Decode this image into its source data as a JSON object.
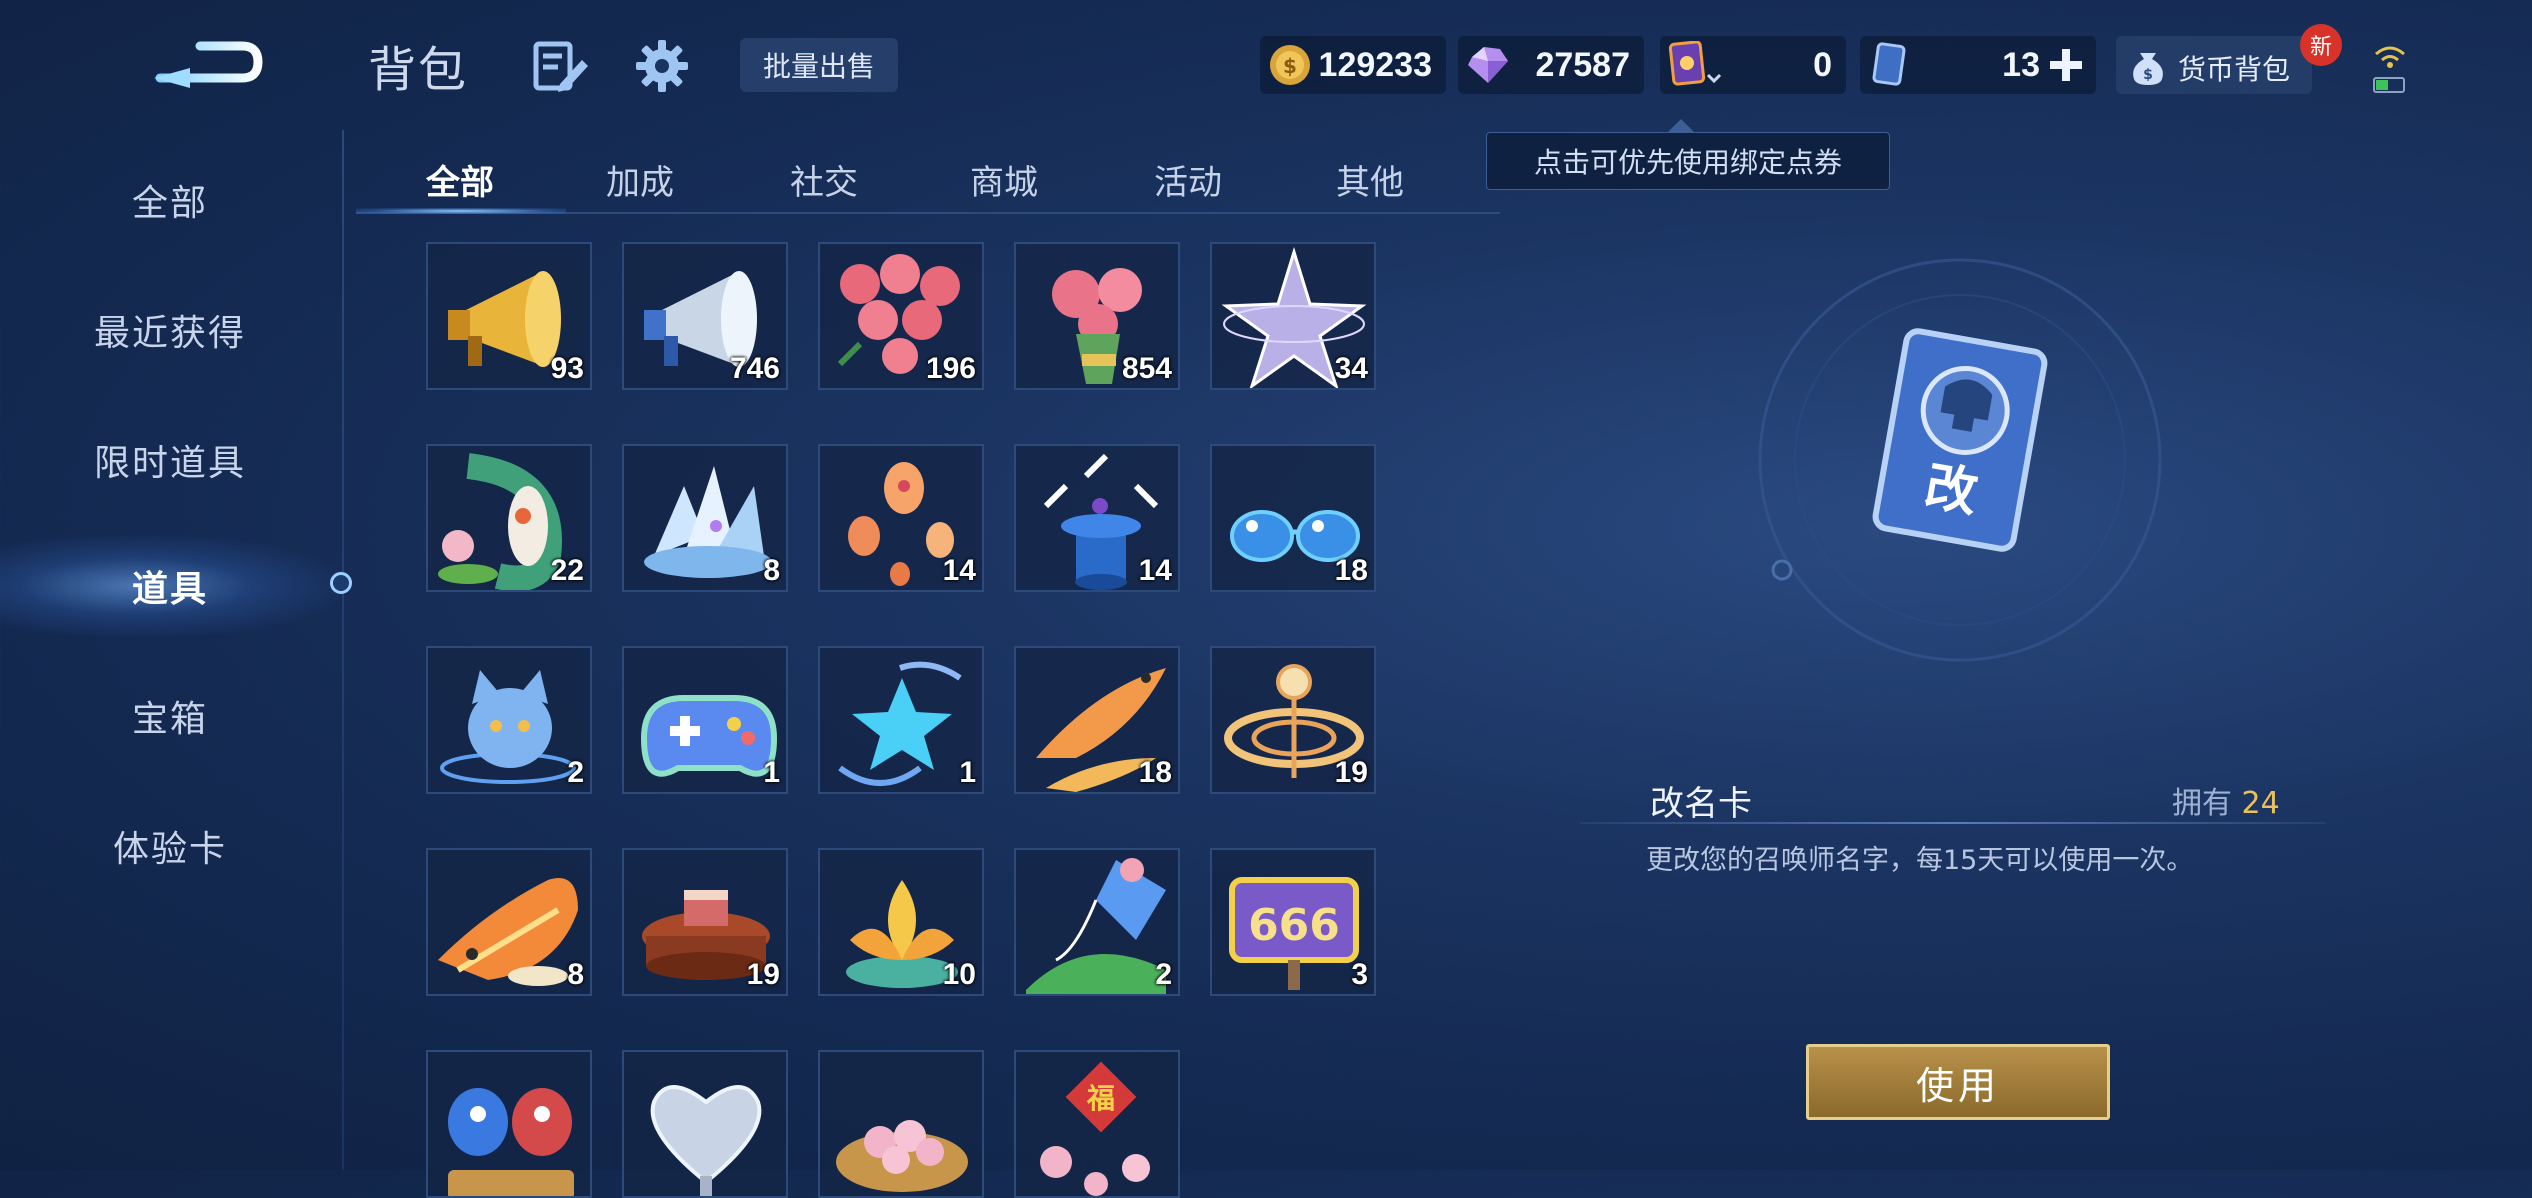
{
  "header": {
    "title": "背包",
    "bulk_sell": "批量出售"
  },
  "currencies": {
    "gold": "129233",
    "diamond": "27587",
    "voucher": "0",
    "ticket": "13",
    "wallet_label": "货币背包",
    "new_badge": "新"
  },
  "tooltip": "点击可优先使用绑定点券",
  "sidebar": {
    "items": [
      {
        "label": "全部"
      },
      {
        "label": "最近获得"
      },
      {
        "label": "限时道具"
      },
      {
        "label": "道具"
      },
      {
        "label": "宝箱"
      },
      {
        "label": "体验卡"
      }
    ],
    "active_index": 3
  },
  "tabs": [
    {
      "label": "全部"
    },
    {
      "label": "加成"
    },
    {
      "label": "社交"
    },
    {
      "label": "商城"
    },
    {
      "label": "活动"
    },
    {
      "label": "其他"
    }
  ],
  "grid": {
    "rows": [
      [
        {
          "icon": "gold-megaphone-icon",
          "count": "93"
        },
        {
          "icon": "silver-megaphone-icon",
          "count": "746"
        },
        {
          "icon": "rose-bouquet-icon",
          "count": "196"
        },
        {
          "icon": "rose-bouquet-small-icon",
          "count": "854"
        },
        {
          "icon": "crystal-star-icon",
          "count": "34"
        }
      ],
      [
        {
          "icon": "koi-lotus-icon",
          "count": "22"
        },
        {
          "icon": "ice-crystal-icon",
          "count": "8"
        },
        {
          "icon": "sky-lantern-icon",
          "count": "14"
        },
        {
          "icon": "magic-hat-icon",
          "count": "14"
        },
        {
          "icon": "sunglasses-icon",
          "count": "18"
        }
      ],
      [
        {
          "icon": "blue-cat-icon",
          "count": "2"
        },
        {
          "icon": "gamepad-icon",
          "count": "1"
        },
        {
          "icon": "star-fish-icon",
          "count": "1"
        },
        {
          "icon": "golden-koi-icon",
          "count": "18"
        },
        {
          "icon": "golden-ribbon-icon",
          "count": "19"
        }
      ],
      [
        {
          "icon": "fire-dragon-icon",
          "count": "8"
        },
        {
          "icon": "hotpot-icon",
          "count": "19"
        },
        {
          "icon": "golden-lotus-icon",
          "count": "10"
        },
        {
          "icon": "kite-icon",
          "count": "2"
        },
        {
          "icon": "666-sign-icon",
          "count": "3"
        }
      ],
      [
        {
          "icon": "bird-couple-icon",
          "count": ""
        },
        {
          "icon": "silver-heart-icon",
          "count": ""
        },
        {
          "icon": "sakura-plate-icon",
          "count": ""
        },
        {
          "icon": "fortune-blossom-icon",
          "count": ""
        }
      ]
    ]
  },
  "detail": {
    "card_char": "改",
    "name": "改名卡",
    "own_label": "拥有",
    "own_value": "24",
    "description": "更改您的召唤师名字，每15天可以使用一次。",
    "use_button": "使用"
  }
}
